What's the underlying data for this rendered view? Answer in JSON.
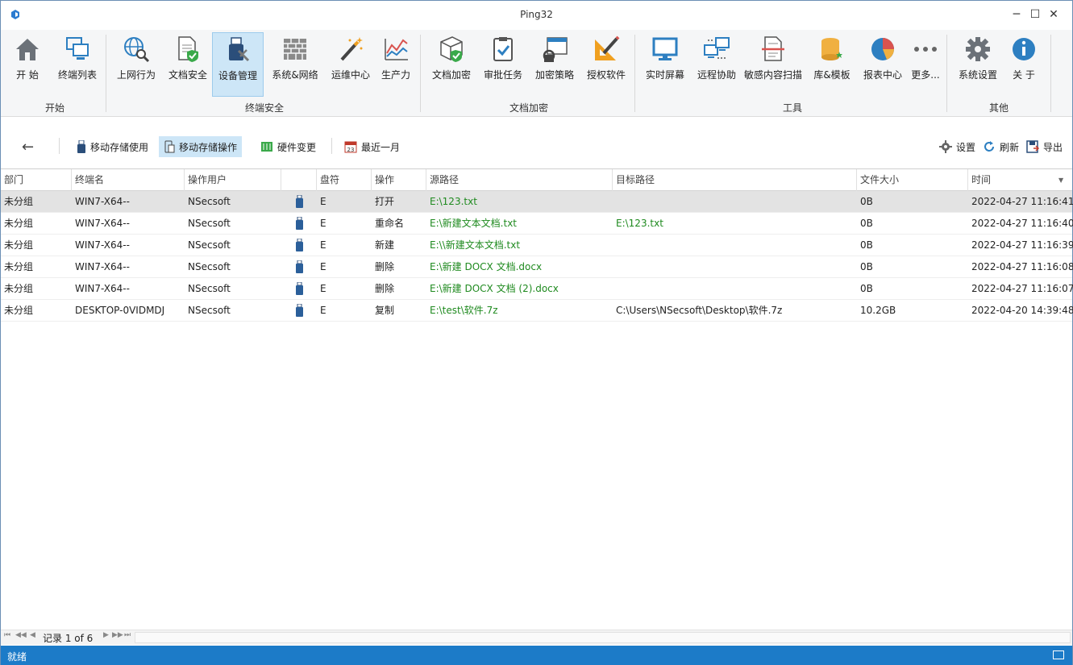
{
  "window": {
    "title": "Ping32",
    "min": "─",
    "max": "☐",
    "close": "✕"
  },
  "ribbon": {
    "items": [
      {
        "label": "开 始",
        "icon": "home-icon"
      },
      {
        "label": "终端列表",
        "icon": "terminal-list-icon"
      },
      {
        "label": "上网行为",
        "icon": "web-behavior-icon"
      },
      {
        "label": "文档安全",
        "icon": "document-security-icon"
      },
      {
        "label": "设备管理",
        "icon": "device-management-icon"
      },
      {
        "label": "系统&网络",
        "icon": "firewall-icon"
      },
      {
        "label": "运维中心",
        "icon": "magic-wand-icon"
      },
      {
        "label": "生产力",
        "icon": "productivity-chart-icon"
      },
      {
        "label": "文档加密",
        "icon": "document-encrypt-icon"
      },
      {
        "label": "审批任务",
        "icon": "approval-clipboard-icon"
      },
      {
        "label": "加密策略",
        "icon": "encrypt-policy-icon"
      },
      {
        "label": "授权软件",
        "icon": "authorized-software-icon"
      },
      {
        "label": "实时屏幕",
        "icon": "monitor-icon"
      },
      {
        "label": "远程协助",
        "icon": "remote-assist-icon"
      },
      {
        "label": "敏感内容扫描",
        "icon": "sensitive-scan-icon"
      },
      {
        "label": "库&模板",
        "icon": "database-icon"
      },
      {
        "label": "报表中心",
        "icon": "pie-chart-icon"
      },
      {
        "label": "更多...",
        "icon": "more-icon"
      },
      {
        "label": "系统设置",
        "icon": "gear-icon"
      },
      {
        "label": "关 于",
        "icon": "info-icon"
      }
    ],
    "groups": [
      "开始",
      "终端安全",
      "文档加密",
      "工具",
      "其他"
    ]
  },
  "toolbar": {
    "back": "←",
    "usb_use": "移动存储使用",
    "usb_ops": "移动存储操作",
    "hardware": "硬件变更",
    "recent": "最近一月",
    "settings": "设置",
    "refresh": "刷新",
    "export": "导出"
  },
  "grid": {
    "columns": [
      "部门",
      "终端名",
      "操作用户",
      "",
      "盘符",
      "操作",
      "源路径",
      "目标路径",
      "文件大小",
      "时间"
    ],
    "rows": [
      {
        "dept": "未分组",
        "terminal": "WIN7-X64--",
        "user": "NSecsoft",
        "drive": "E",
        "op": "打开",
        "src": "E:\\123.txt",
        "dst": "",
        "size": "0B",
        "time": "2022-04-27 11:16:41"
      },
      {
        "dept": "未分组",
        "terminal": "WIN7-X64--",
        "user": "NSecsoft",
        "drive": "E",
        "op": "重命名",
        "src": "E:\\新建文本文档.txt",
        "dst": "E:\\123.txt",
        "size": "0B",
        "time": "2022-04-27 11:16:40"
      },
      {
        "dept": "未分组",
        "terminal": "WIN7-X64--",
        "user": "NSecsoft",
        "drive": "E",
        "op": "新建",
        "src": "E:\\\\新建文本文档.txt",
        "dst": "",
        "size": "0B",
        "time": "2022-04-27 11:16:39"
      },
      {
        "dept": "未分组",
        "terminal": "WIN7-X64--",
        "user": "NSecsoft",
        "drive": "E",
        "op": "删除",
        "src": "E:\\新建 DOCX 文档.docx",
        "dst": "",
        "size": "0B",
        "time": "2022-04-27 11:16:08"
      },
      {
        "dept": "未分组",
        "terminal": "WIN7-X64--",
        "user": "NSecsoft",
        "drive": "E",
        "op": "删除",
        "src": "E:\\新建 DOCX 文档 (2).docx",
        "dst": "",
        "size": "0B",
        "time": "2022-04-27 11:16:07"
      },
      {
        "dept": "未分组",
        "terminal": "DESKTOP-0VIDMDJ",
        "user": "NSecsoft",
        "drive": "E",
        "op": "复制",
        "src": "E:\\test\\软件.7z",
        "dst": "C:\\Users\\NSecsoft\\Desktop\\软件.7z",
        "size": "10.2GB",
        "time": "2022-04-20 14:39:48"
      }
    ]
  },
  "pager": {
    "text": "记录 1 of 6",
    "first": "⏮",
    "prev_page": "◀◀",
    "prev": "◀",
    "next": "▶",
    "next_page": "▶▶",
    "last": "⏭"
  },
  "status": {
    "text": "就绪"
  },
  "colors": {
    "accent": "#1c7bc8",
    "selected": "#cde6f7",
    "path_green": "#1f8a1f"
  }
}
